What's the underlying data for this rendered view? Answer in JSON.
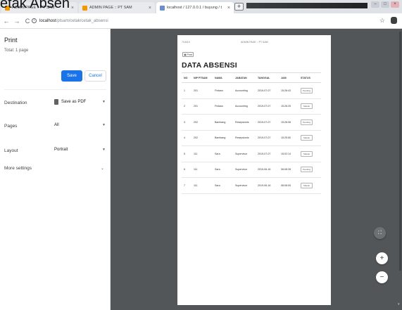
{
  "caption": "etak Absen",
  "tabs": [
    {
      "title": "ADMIN PAGE :: PT SAM",
      "icon": "pma-favicon"
    },
    {
      "title": "ADMIN PAGE :: PT SAM",
      "icon": "admin-favicon"
    },
    {
      "title": "localhost / 127.0.0.1 / buyung / t",
      "icon": "phpmyadmin-favicon"
    }
  ],
  "tab_close": "×",
  "newtab": "+",
  "toolbar": {
    "back": "←",
    "forward": "→",
    "reload": "C",
    "url_host": "localhost",
    "url_path": "/ptsam/cetak/cetak_absensi",
    "star": "☆"
  },
  "print_panel": {
    "title": "Print",
    "total": "Total: 1 page",
    "save_label": "Save",
    "cancel_label": "Cancel",
    "destination_label": "Destination",
    "destination_value": "Save as PDF",
    "pages_label": "Pages",
    "pages_value": "All",
    "layout_label": "Layout",
    "layout_value": "Portrait",
    "more_settings_label": "More settings"
  },
  "sheet": {
    "header_left": "7/16/19",
    "header_center": "ADMIN PAGE :: PT SAM",
    "print_button": "Print",
    "title": "DATA ABSENSI",
    "columns": [
      "NO",
      "NIP PTSAM",
      "NAMA",
      "JABATAN",
      "TANGGAL",
      "JAM",
      "STATUS"
    ],
    "rows": [
      [
        "1",
        "201",
        "Firdaus",
        "Accounting",
        "2019-07-07",
        "15:26:43",
        "Pending"
      ],
      [
        "2",
        "201",
        "Firdaus",
        "Accounting",
        "2019-07-07",
        "15:26:25",
        "Masuk"
      ],
      [
        "3",
        "202",
        "Bambang",
        "Resepsionis",
        "2019-07-07",
        "15:26:08",
        "Pending"
      ],
      [
        "4",
        "202",
        "Bambang",
        "Resepsionis",
        "2019-07-07",
        "15:25:50",
        "Masuk"
      ],
      [
        "5",
        "111",
        "Sara",
        "Supervisor",
        "2019-07-07",
        "15:02:14",
        "Masuk"
      ],
      [
        "6",
        "111",
        "Sara",
        "Supervisor",
        "2019-06-16",
        "08:08:28",
        "Pending"
      ],
      [
        "7",
        "111",
        "Sara",
        "Supervisor",
        "2019-06-16",
        "08:08:05",
        "Masuk"
      ]
    ]
  },
  "zoom": {
    "plus": "+",
    "minus": "−"
  }
}
